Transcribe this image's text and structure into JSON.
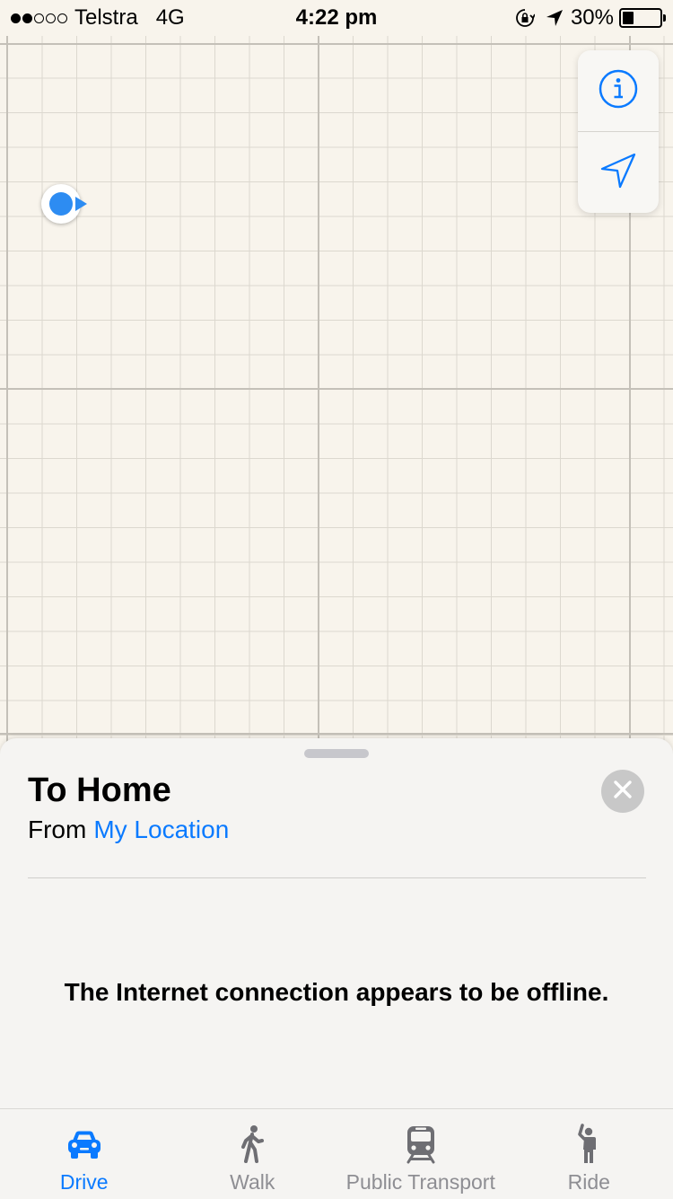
{
  "status_bar": {
    "carrier": "Telstra",
    "network": "4G",
    "time": "4:22 pm",
    "battery_percent": "30%",
    "battery_level": 0.3,
    "signal_bars_filled": 2,
    "signal_bars_total": 5
  },
  "map": {
    "info_button_icon": "info-icon",
    "locate_button_icon": "location-arrow-icon"
  },
  "sheet": {
    "title": "To Home",
    "from_label": "From",
    "from_value": "My Location",
    "message": "The Internet connection appears to be offline."
  },
  "tabs": [
    {
      "label": "Drive",
      "icon": "car-icon",
      "active": true
    },
    {
      "label": "Walk",
      "icon": "walk-icon",
      "active": false
    },
    {
      "label": "Public Transport",
      "icon": "train-icon",
      "active": false
    },
    {
      "label": "Ride",
      "icon": "ride-icon",
      "active": false
    }
  ],
  "colors": {
    "accent": "#0a7aff",
    "location_dot": "#2d8cf2",
    "inactive_tab": "#8e8e93"
  }
}
